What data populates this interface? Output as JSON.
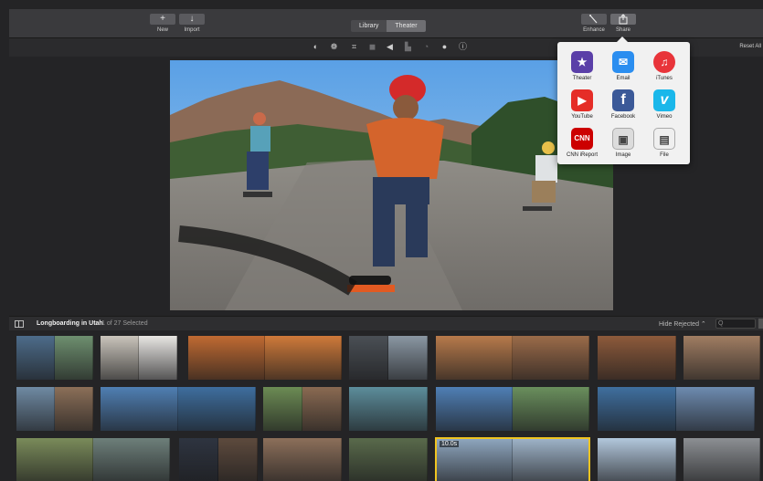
{
  "toolbar": {
    "new_label": "New",
    "import_label": "Import",
    "new_glyph": "+",
    "import_glyph": "↓",
    "tabs": [
      {
        "label": "Library",
        "active": false
      },
      {
        "label": "Theater",
        "active": true
      }
    ],
    "enhance_label": "Enhance",
    "share_label": "Share",
    "enhance_icon": "magic-wand-icon",
    "share_icon": "share-icon"
  },
  "adjust": {
    "icons": [
      "color-balance-icon",
      "color-correction-icon",
      "crop-icon",
      "stabilization-icon",
      "volume-icon",
      "noise-reduction-icon",
      "speed-icon",
      "clip-filter-icon",
      "info-icon"
    ],
    "reset_label": "Reset All"
  },
  "share_menu": {
    "items": [
      {
        "label": "Theater",
        "icon": "theater-icon",
        "color": "#5a3fa8",
        "glyph": "★"
      },
      {
        "label": "Email",
        "icon": "email-icon",
        "color": "#2b8ef0",
        "glyph": "✉"
      },
      {
        "label": "iTunes",
        "icon": "itunes-icon",
        "color": "#e8343a",
        "glyph": "♫"
      },
      {
        "label": "YouTube",
        "icon": "youtube-icon",
        "color": "#e52d27",
        "glyph": "▶"
      },
      {
        "label": "Facebook",
        "icon": "facebook-icon",
        "color": "#3b5998",
        "glyph": "f"
      },
      {
        "label": "Vimeo",
        "icon": "vimeo-icon",
        "color": "#1ab7ea",
        "glyph": "v"
      },
      {
        "label": "CNN iReport",
        "icon": "cnn-ireport-icon",
        "color": "#cc0000",
        "glyph": "CNN"
      },
      {
        "label": "Image",
        "icon": "image-icon",
        "color": "#8c8c8c",
        "glyph": "▣"
      },
      {
        "label": "File",
        "icon": "file-icon",
        "color": "#dcdcdc",
        "glyph": "▤"
      }
    ]
  },
  "browser": {
    "event_title": "Longboarding in Utah",
    "selection_text": "1 of 27 Selected",
    "hide_rejected_label": "Hide Rejected ⌃",
    "search_glyph": "Q"
  },
  "clips": [
    {
      "row": 0,
      "frames": [
        "#4d6c8a",
        "#6e8f6f"
      ],
      "duration": ""
    },
    {
      "row": 0,
      "frames": [
        "#c9c4bb",
        "#e8e6e3"
      ],
      "duration": ""
    },
    {
      "row": 0,
      "frames": [
        "#c06a32",
        "#cf7a3a"
      ],
      "duration": ""
    },
    {
      "row": 0,
      "frames": [
        "#4a4f55",
        "#8a97a3"
      ],
      "duration": ""
    },
    {
      "row": 0,
      "frames": [
        "#b77a4b",
        "#9b6b49"
      ],
      "duration": ""
    },
    {
      "row": 0,
      "frames": [
        "#8d5a3b"
      ],
      "duration": ""
    },
    {
      "row": 0,
      "frames": [
        "#a07d62"
      ],
      "duration": ""
    },
    {
      "row": 1,
      "frames": [
        "#6f8aa3",
        "#8b6f58"
      ],
      "duration": ""
    },
    {
      "row": 1,
      "frames": [
        "#4f7fb3",
        "#3e6e9e"
      ],
      "duration": ""
    },
    {
      "row": 1,
      "frames": [
        "#6c8b54",
        "#8a6a52"
      ],
      "duration": ""
    },
    {
      "row": 1,
      "frames": [
        "#5c8d9b"
      ],
      "duration": ""
    },
    {
      "row": 1,
      "frames": [
        "#4f7fb5",
        "#6a8f5d"
      ],
      "duration": ""
    },
    {
      "row": 1,
      "frames": [
        "#3f6f9f",
        "#6d8bb0"
      ],
      "duration": ""
    },
    {
      "row": 2,
      "frames": [
        "#7a8b5a",
        "#6d7f7a"
      ],
      "duration": ""
    },
    {
      "row": 2,
      "frames": [
        "#2e3440",
        "#5d4a3d"
      ],
      "duration": ""
    },
    {
      "row": 2,
      "frames": [
        "#8c6f5a"
      ],
      "duration": ""
    },
    {
      "row": 2,
      "frames": [
        "#596a4b"
      ],
      "duration": ""
    },
    {
      "row": 2,
      "frames": [
        "#8fa7c0",
        "#9fb4c9"
      ],
      "duration": "10.0s",
      "selected": true
    },
    {
      "row": 2,
      "frames": [
        "#b2c7dc"
      ],
      "duration": ""
    },
    {
      "row": 2,
      "frames": [
        "#8c8f93"
      ],
      "duration": ""
    }
  ]
}
